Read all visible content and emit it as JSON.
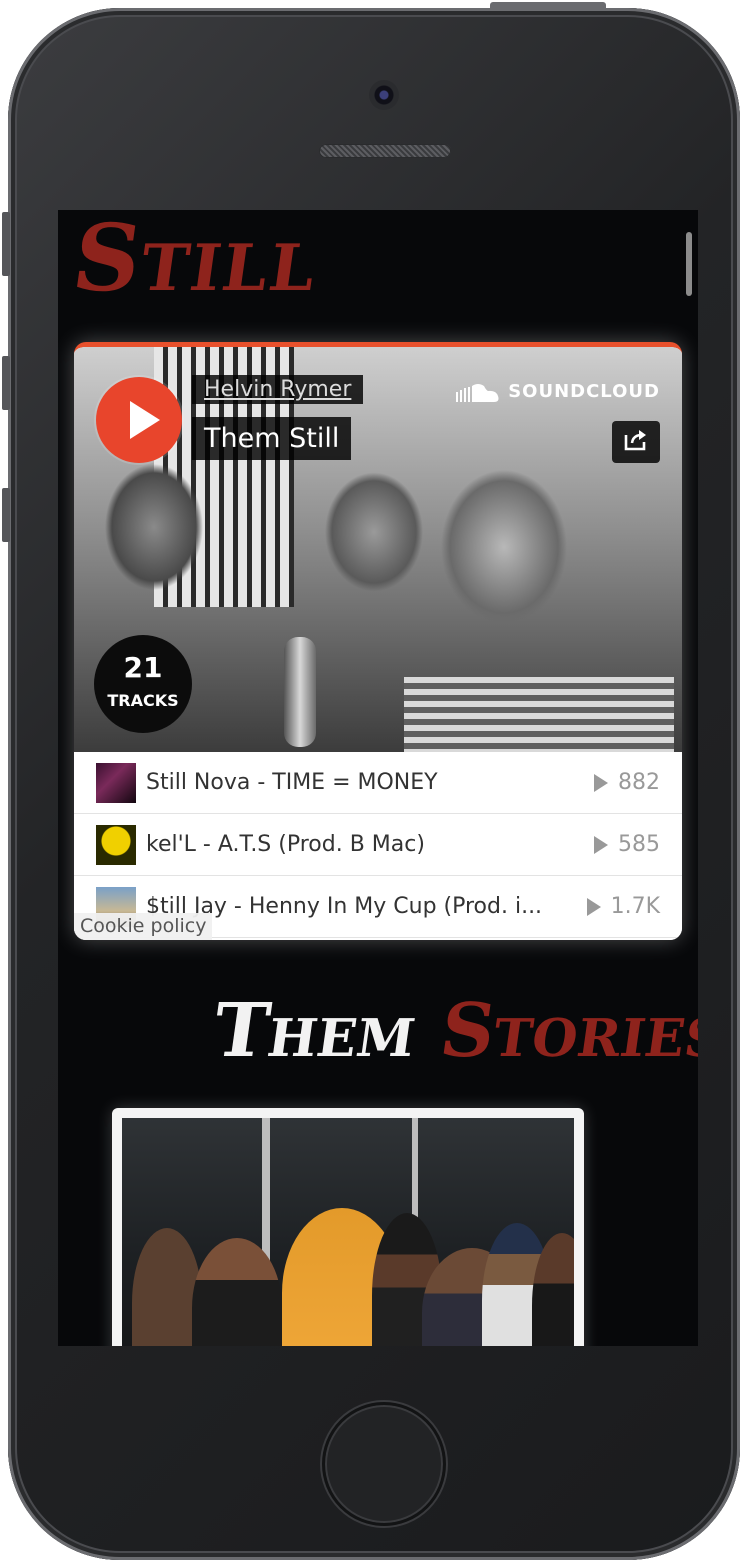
{
  "page": {
    "heading": "Still"
  },
  "soundcloud": {
    "artist": "Helvin Rymer",
    "playlist_title": "Them Still",
    "logo_text": "SOUNDCLOUD",
    "track_count": "21",
    "track_count_label": "TRACKS",
    "cookie_policy": "Cookie policy",
    "tracks": [
      {
        "title": "Still Nova - TIME = MONEY",
        "plays": "882"
      },
      {
        "title": "kel'L - A.T.S (Prod. B Mac)",
        "plays": "585"
      },
      {
        "title": "$till Jay - Henny In My Cup (Prod. i...",
        "plays": "1.7K"
      }
    ],
    "accent_color": "#e8502c"
  },
  "stories": {
    "word1": "Them",
    "word2": "Stories"
  },
  "icons": [
    "play-icon",
    "soundcloud-logo-icon",
    "share-icon",
    "play-count-icon"
  ]
}
